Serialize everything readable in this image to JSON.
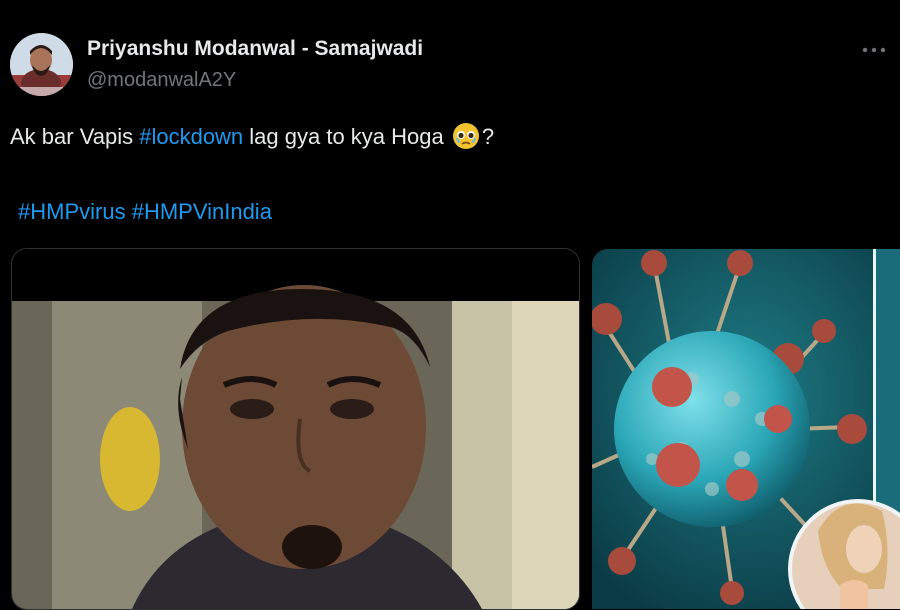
{
  "author": {
    "display_name": "Priyanshu Modanwal - Samajwadi",
    "handle": "@modanwalA2Y"
  },
  "tweet": {
    "text_before": "Ak bar Vapis  ",
    "hashtag_lockdown": "#lockdown",
    "text_after": " lag gya to kya Hoga ",
    "text_end": "?",
    "emoji": "pleading-face-with-tears",
    "hashtags": [
      "#HMPvirus",
      "#HMPVinIndia"
    ]
  },
  "media": [
    {
      "name": "scared-man-photo"
    },
    {
      "name": "virus-illustration-with-coughing-woman"
    }
  ],
  "colors": {
    "background": "#000000",
    "text": "#e7e9ea",
    "secondary_text": "#71767b",
    "link": "#1d9bf0",
    "border": "#2f3336"
  },
  "icons": {
    "more": "more-dots-icon"
  }
}
